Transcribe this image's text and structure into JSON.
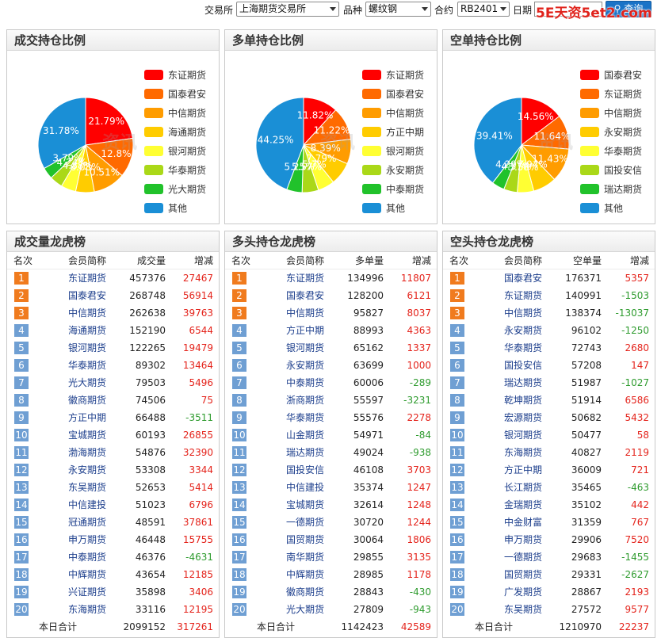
{
  "filter": {
    "exchange_label": "交易所",
    "exchange_value": "上海期货交易所",
    "variety_label": "品种",
    "variety_value": "螺纹钢",
    "contract_label": "合约",
    "contract_value": "RB2401",
    "date_label": "日期",
    "date_value": "",
    "query_label": "查询",
    "watermark": "5E天资5et2.com"
  },
  "pie_watermark": "资讯",
  "pies": [
    {
      "title": "成交持仓比例",
      "legend": [
        "东证期货",
        "国泰君安",
        "中信期货",
        "海通期货",
        "银河期货",
        "华泰期货",
        "光大期货",
        "其他"
      ],
      "values": [
        21.79,
        12.8,
        10.51,
        6.08,
        4.88,
        4.24,
        3.79,
        31.78
      ],
      "labels": [
        "21.79%",
        "12.8%",
        "10.51%",
        "6.08%",
        "4.88%",
        "4.24%",
        "3.79%",
        "31.78%"
      ]
    },
    {
      "title": "多单持仓比例",
      "legend": [
        "东证期货",
        "国泰君安",
        "中信期货",
        "方正中期",
        "银河期货",
        "永安期货",
        "中泰期货",
        "其他"
      ],
      "values": [
        11.82,
        11.22,
        8.39,
        7.79,
        5.7,
        5.57,
        5.25,
        44.25
      ],
      "labels": [
        "11.82%",
        "11.22%",
        "8.39%",
        "7.79%",
        "5.7%",
        "5.57%",
        "5.25%",
        "44.25%"
      ]
    },
    {
      "title": "空单持仓比例",
      "legend": [
        "国泰君安",
        "东证期货",
        "中信期货",
        "永安期货",
        "华泰期货",
        "国投安信",
        "瑞达期货",
        "其他"
      ],
      "values": [
        14.56,
        11.64,
        11.43,
        7.94,
        5.58,
        4.57,
        4.29,
        39.41
      ],
      "labels": [
        "14.56%",
        "11.64%",
        "11.43%",
        "7.94%",
        "5.58%",
        "4.57%",
        "4.29%",
        "39.41%"
      ]
    }
  ],
  "pie_colors": [
    "#ff0000",
    "#ff6a00",
    "#ff9c00",
    "#ffcc00",
    "#ffff33",
    "#aad818",
    "#21c22b",
    "#1a8fd6"
  ],
  "tables": [
    {
      "title": "成交量龙虎榜",
      "headers": [
        "名次",
        "会员简称",
        "成交量",
        "增减"
      ],
      "rows": [
        [
          "1",
          "东证期货",
          "457376",
          "27467"
        ],
        [
          "2",
          "国泰君安",
          "268748",
          "56914"
        ],
        [
          "3",
          "中信期货",
          "262638",
          "39763"
        ],
        [
          "4",
          "海通期货",
          "152190",
          "6544"
        ],
        [
          "5",
          "银河期货",
          "122265",
          "19479"
        ],
        [
          "6",
          "华泰期货",
          "89302",
          "13464"
        ],
        [
          "7",
          "光大期货",
          "79503",
          "5496"
        ],
        [
          "8",
          "徽商期货",
          "74506",
          "75"
        ],
        [
          "9",
          "方正中期",
          "66488",
          "-3511"
        ],
        [
          "10",
          "宝城期货",
          "60193",
          "26855"
        ],
        [
          "11",
          "渤海期货",
          "54876",
          "32390"
        ],
        [
          "12",
          "永安期货",
          "53308",
          "3344"
        ],
        [
          "13",
          "东吴期货",
          "52653",
          "5414"
        ],
        [
          "14",
          "中信建投",
          "51023",
          "6796"
        ],
        [
          "15",
          "冠通期货",
          "48591",
          "37861"
        ],
        [
          "16",
          "申万期货",
          "46448",
          "15755"
        ],
        [
          "17",
          "中泰期货",
          "46376",
          "-4631"
        ],
        [
          "18",
          "中辉期货",
          "43654",
          "12185"
        ],
        [
          "19",
          "兴证期货",
          "35898",
          "3406"
        ],
        [
          "20",
          "东海期货",
          "33116",
          "12195"
        ]
      ],
      "total": [
        "本日合计",
        "2099152",
        "317261"
      ]
    },
    {
      "title": "多头持仓龙虎榜",
      "headers": [
        "名次",
        "会员简称",
        "多单量",
        "增减"
      ],
      "rows": [
        [
          "1",
          "东证期货",
          "134996",
          "11807"
        ],
        [
          "2",
          "国泰君安",
          "128200",
          "6121"
        ],
        [
          "3",
          "中信期货",
          "95827",
          "8037"
        ],
        [
          "4",
          "方正中期",
          "88993",
          "4363"
        ],
        [
          "5",
          "银河期货",
          "65162",
          "1337"
        ],
        [
          "6",
          "永安期货",
          "63699",
          "1000"
        ],
        [
          "7",
          "中泰期货",
          "60006",
          "-289"
        ],
        [
          "8",
          "浙商期货",
          "55597",
          "-3231"
        ],
        [
          "9",
          "华泰期货",
          "55576",
          "2278"
        ],
        [
          "10",
          "山金期货",
          "54971",
          "-84"
        ],
        [
          "11",
          "瑞达期货",
          "49024",
          "-938"
        ],
        [
          "12",
          "国投安信",
          "46108",
          "3703"
        ],
        [
          "13",
          "中信建投",
          "35374",
          "1247"
        ],
        [
          "14",
          "宝城期货",
          "32614",
          "1248"
        ],
        [
          "15",
          "一德期货",
          "30720",
          "1244"
        ],
        [
          "16",
          "国贸期货",
          "30064",
          "1806"
        ],
        [
          "17",
          "南华期货",
          "29855",
          "3135"
        ],
        [
          "18",
          "中辉期货",
          "28985",
          "1178"
        ],
        [
          "19",
          "徽商期货",
          "28843",
          "-430"
        ],
        [
          "20",
          "光大期货",
          "27809",
          "-943"
        ]
      ],
      "total": [
        "本日合计",
        "1142423",
        "42589"
      ]
    },
    {
      "title": "空头持仓龙虎榜",
      "headers": [
        "名次",
        "会员简称",
        "空单量",
        "增减"
      ],
      "rows": [
        [
          "1",
          "国泰君安",
          "176371",
          "5357"
        ],
        [
          "2",
          "东证期货",
          "140991",
          "-1503"
        ],
        [
          "3",
          "中信期货",
          "138374",
          "-13037"
        ],
        [
          "4",
          "永安期货",
          "96102",
          "-1250"
        ],
        [
          "5",
          "华泰期货",
          "72743",
          "2680"
        ],
        [
          "6",
          "国投安信",
          "57208",
          "147"
        ],
        [
          "7",
          "瑞达期货",
          "51987",
          "-1027"
        ],
        [
          "8",
          "乾坤期货",
          "51914",
          "6586"
        ],
        [
          "9",
          "宏源期货",
          "50682",
          "5432"
        ],
        [
          "10",
          "银河期货",
          "50477",
          "58"
        ],
        [
          "11",
          "东海期货",
          "40827",
          "2119"
        ],
        [
          "12",
          "方正中期",
          "36009",
          "721"
        ],
        [
          "13",
          "长江期货",
          "35465",
          "-463"
        ],
        [
          "14",
          "金瑞期货",
          "35102",
          "442"
        ],
        [
          "15",
          "中金财富",
          "31359",
          "767"
        ],
        [
          "16",
          "申万期货",
          "29906",
          "7520"
        ],
        [
          "17",
          "一德期货",
          "29683",
          "-1455"
        ],
        [
          "18",
          "国贸期货",
          "29331",
          "-2627"
        ],
        [
          "19",
          "广发期货",
          "28867",
          "2193"
        ],
        [
          "20",
          "东吴期货",
          "27572",
          "9577"
        ]
      ],
      "total": [
        "本日合计",
        "1210970",
        "22237"
      ]
    }
  ]
}
